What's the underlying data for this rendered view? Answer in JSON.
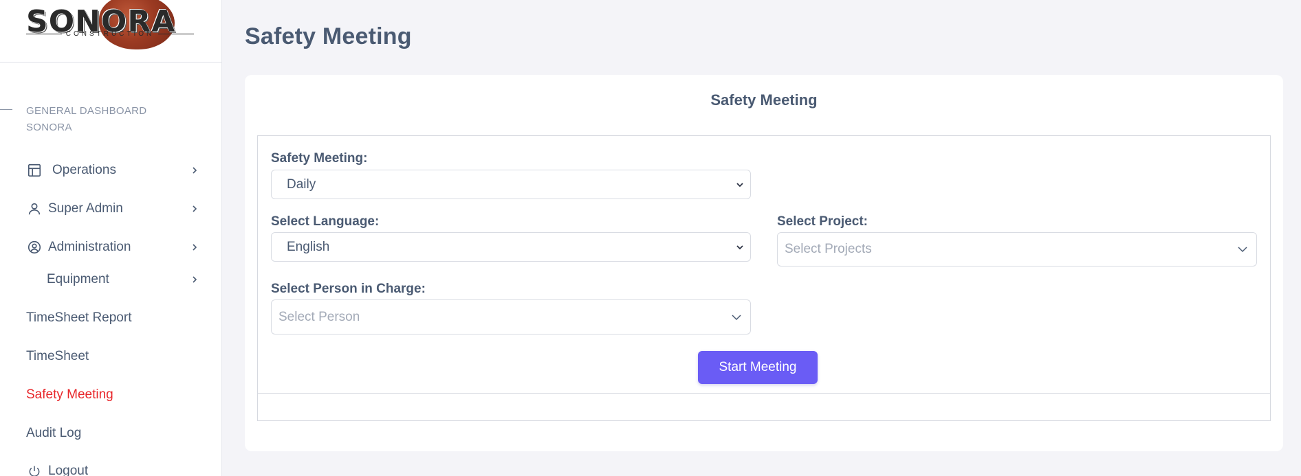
{
  "brand": {
    "name": "SONORA",
    "subtitle": "CONSTRUCTION"
  },
  "sidebar": {
    "section_title": "GENERAL DASHBOARD SONORA",
    "items": [
      {
        "label": "Operations",
        "icon": "layout-icon",
        "has_chevron": true
      },
      {
        "label": "Super Admin",
        "icon": "user-icon",
        "has_chevron": true
      },
      {
        "label": "Administration",
        "icon": "user-circle-icon",
        "has_chevron": true
      },
      {
        "label": "Equipment",
        "icon": "",
        "has_chevron": true
      },
      {
        "label": "TimeSheet Report",
        "icon": "",
        "has_chevron": false
      },
      {
        "label": "TimeSheet",
        "icon": "",
        "has_chevron": false
      },
      {
        "label": "Safety Meeting",
        "icon": "",
        "has_chevron": false,
        "active": true
      },
      {
        "label": "Audit Log",
        "icon": "",
        "has_chevron": false
      },
      {
        "label": "Logout",
        "icon": "power-icon",
        "has_chevron": false
      }
    ]
  },
  "page": {
    "title": "Safety Meeting"
  },
  "card": {
    "title": "Safety Meeting"
  },
  "form": {
    "meeting_type": {
      "label": "Safety Meeting:",
      "value": "Daily"
    },
    "language": {
      "label": "Select Language:",
      "value": "English"
    },
    "project": {
      "label": "Select Project:",
      "placeholder": "Select Projects"
    },
    "person": {
      "label": "Select Person in Charge:",
      "placeholder": "Select Person"
    },
    "start_button": "Start Meeting"
  },
  "colors": {
    "accent": "#6a5cf5",
    "active_nav": "#e8262a",
    "text": "#4a5a72",
    "background": "#f4f4f8"
  }
}
